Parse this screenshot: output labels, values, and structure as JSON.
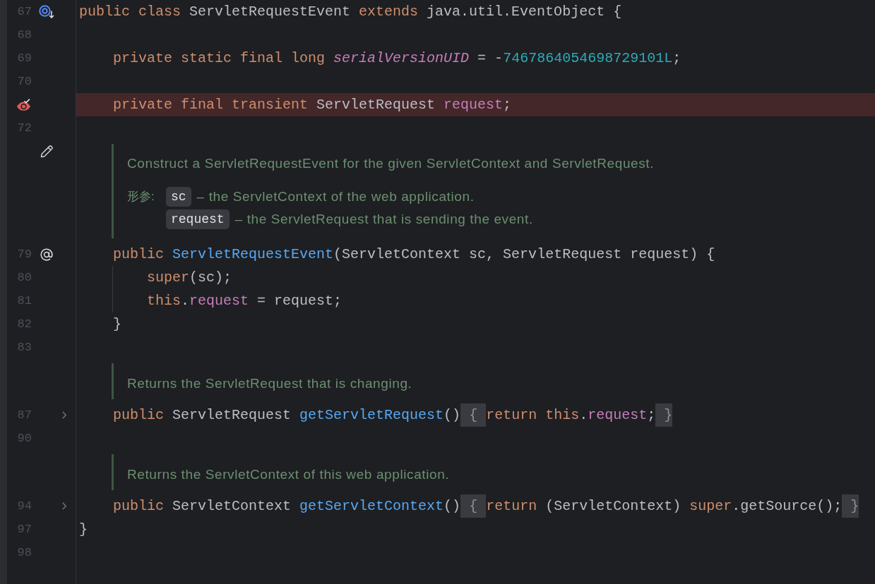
{
  "editor": {
    "lines": [
      {
        "kind": "code",
        "number": "67",
        "marker": {
          "kind": "implements"
        },
        "highlighted": false,
        "tokens": [
          {
            "text": "public class ",
            "kind": "keyword"
          },
          {
            "text": "ServletRequestEvent ",
            "kind": "plain"
          },
          {
            "text": "extends ",
            "kind": "keyword"
          },
          {
            "text": "java.util.EventObject {",
            "kind": "plain"
          }
        ]
      },
      {
        "kind": "code",
        "number": "68",
        "highlighted": false
      },
      {
        "kind": "code",
        "number": "69",
        "highlighted": false,
        "tokens": [
          {
            "text": "    private static final long ",
            "kind": "keyword"
          },
          {
            "text": "serialVersionUID",
            "kind": "static_field"
          },
          {
            "text": " = -",
            "kind": "plain"
          },
          {
            "text": "7467864054698729101L",
            "kind": "number"
          },
          {
            "text": ";",
            "kind": "plain"
          }
        ]
      },
      {
        "kind": "code",
        "number": "70",
        "highlighted": false
      },
      {
        "kind": "code",
        "marker": {
          "kind": "watchpoint"
        },
        "highlighted": true,
        "tokens": [
          {
            "text": "    private final transient ",
            "kind": "keyword"
          },
          {
            "text": "ServletRequest ",
            "kind": "plain"
          },
          {
            "text": "request",
            "kind": "field"
          },
          {
            "text": ";",
            "kind": "plain"
          }
        ]
      },
      {
        "kind": "code",
        "number": "72",
        "highlighted": false
      },
      {
        "kind": "doc",
        "marker": {
          "kind": "edit"
        },
        "text": "Construct a ServletRequestEvent for the given ServletContext and ServletRequest.",
        "params_label": "形参:",
        "params": [
          {
            "name": "sc",
            "description": "– the ServletContext of the web application."
          },
          {
            "name": "request",
            "description": "– the ServletRequest that is sending the event."
          }
        ]
      },
      {
        "kind": "code",
        "number": "79",
        "marker": {
          "kind": "related"
        },
        "highlighted": false,
        "tokens": [
          {
            "text": "    public ",
            "kind": "keyword"
          },
          {
            "text": "ServletRequestEvent",
            "kind": "method"
          },
          {
            "text": "(ServletContext sc, ServletRequest request) {",
            "kind": "plain"
          }
        ]
      },
      {
        "kind": "code",
        "number": "80",
        "highlighted": false,
        "tokens": [
          {
            "text": "        super",
            "kind": "keyword"
          },
          {
            "text": "(sc);",
            "kind": "plain"
          }
        ]
      },
      {
        "kind": "code",
        "number": "81",
        "highlighted": false,
        "tokens": [
          {
            "text": "        this",
            "kind": "keyword"
          },
          {
            "text": ".",
            "kind": "plain"
          },
          {
            "text": "request",
            "kind": "field"
          },
          {
            "text": " = request;",
            "kind": "plain"
          }
        ]
      },
      {
        "kind": "code",
        "number": "82",
        "highlighted": false,
        "tokens": [
          {
            "text": "    }",
            "kind": "plain"
          }
        ]
      },
      {
        "kind": "code",
        "number": "83",
        "highlighted": false
      },
      {
        "kind": "doc",
        "text": "Returns the ServletRequest that is changing."
      },
      {
        "kind": "code",
        "number": "87",
        "folded": true,
        "highlighted": false,
        "tokens": [
          {
            "text": "    public ",
            "kind": "keyword"
          },
          {
            "text": "ServletRequest ",
            "kind": "plain"
          },
          {
            "text": "getServletRequest",
            "kind": "method"
          },
          {
            "text": "()",
            "kind": "plain"
          },
          {
            "text": " { ",
            "kind": "fold"
          },
          {
            "text": "return this",
            "kind": "keyword"
          },
          {
            "text": ".",
            "kind": "plain"
          },
          {
            "text": "request",
            "kind": "field"
          },
          {
            "text": ";",
            "kind": "plain"
          },
          {
            "text": " }",
            "kind": "fold"
          }
        ]
      },
      {
        "kind": "code",
        "number": "90",
        "highlighted": false
      },
      {
        "kind": "doc",
        "text": "Returns the ServletContext of this web application."
      },
      {
        "kind": "code",
        "number": "94",
        "folded": true,
        "highlighted": false,
        "tokens": [
          {
            "text": "    public ",
            "kind": "keyword"
          },
          {
            "text": "ServletContext ",
            "kind": "plain"
          },
          {
            "text": "getServletContext",
            "kind": "method"
          },
          {
            "text": "()",
            "kind": "plain"
          },
          {
            "text": " { ",
            "kind": "fold"
          },
          {
            "text": "return ",
            "kind": "keyword"
          },
          {
            "text": "(ServletContext) ",
            "kind": "plain"
          },
          {
            "text": "super",
            "kind": "keyword"
          },
          {
            "text": ".getSource();",
            "kind": "plain"
          },
          {
            "text": " }",
            "kind": "fold"
          }
        ]
      },
      {
        "kind": "code",
        "number": "97",
        "highlighted": false,
        "tokens": [
          {
            "text": "}",
            "kind": "plain"
          }
        ]
      },
      {
        "kind": "code",
        "number": "98",
        "highlighted": false
      }
    ]
  }
}
